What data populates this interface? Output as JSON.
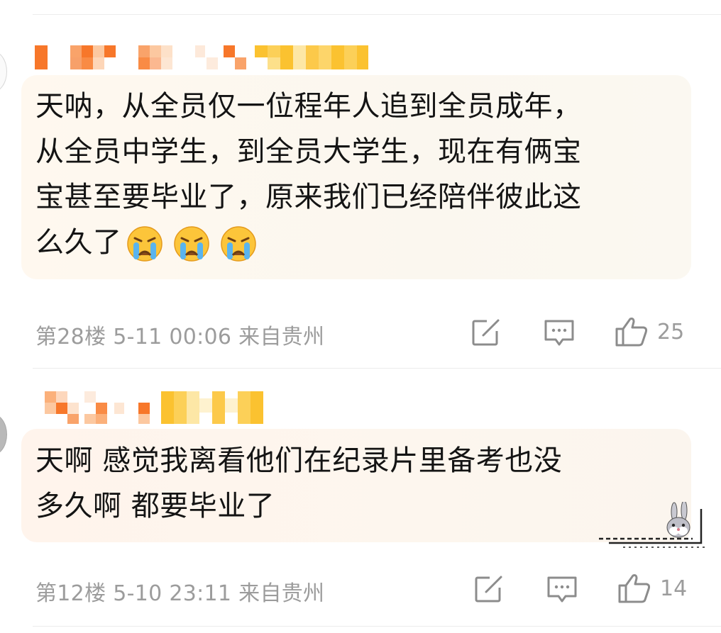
{
  "comments": [
    {
      "text": "天呐，从全员仅一位程年人追到全员成年，\n从全员中学生，到全员大学生，现在有俩宝\n宝甚至要毕业了，原来我们已经陪伴彼此这\n么久了",
      "emoji_icons": [
        "crying-face-icon",
        "crying-face-icon",
        "crying-face-icon"
      ],
      "floor": "第28楼",
      "date": "5-11 00:06",
      "location": "来自贵州",
      "likes": "25"
    },
    {
      "text": "天啊 感觉我离看他们在纪录片里备考也没\n多久啊 都要毕业了",
      "floor": "第12楼",
      "date": "5-10 23:11",
      "location": "来自贵州",
      "likes": "14",
      "decoration_icon": "bunny-bubble-decoration-icon"
    }
  ],
  "icons": {
    "edit": "edit-icon",
    "reply": "comment-icon",
    "like": "thumbs-up-icon"
  },
  "colors": {
    "text": "#141414",
    "meta": "#9c9c9c",
    "bubble": "#fbf7ef",
    "mosaic_orange": "#f7772a",
    "mosaic_yellow": "#fbc230"
  }
}
